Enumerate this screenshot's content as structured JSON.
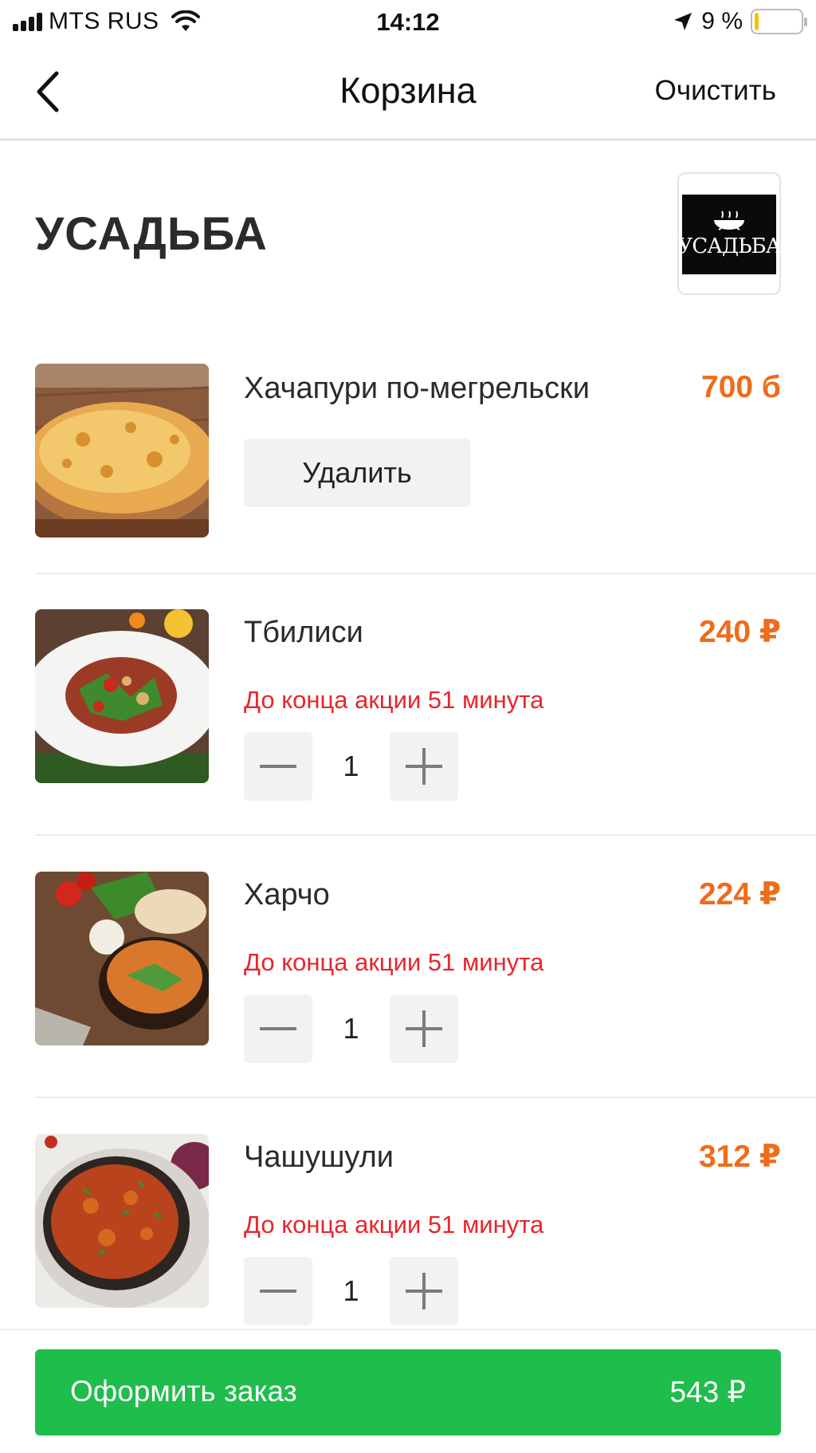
{
  "status_bar": {
    "carrier": "MTS RUS",
    "time": "14:12",
    "battery_percent": "9 %",
    "battery_level": 0.09,
    "icons": [
      "signal-icon",
      "wifi-icon",
      "location-arrow-icon",
      "battery-icon"
    ]
  },
  "nav": {
    "back_icon": "chevron-left-icon",
    "title": "Корзина",
    "clear_label": "Очистить"
  },
  "restaurant": {
    "name": "УСАДЬБА",
    "logo_text": "УСАДЬБА"
  },
  "items": [
    {
      "name": "Хачапури по-мегрельски",
      "price": "700 б",
      "action_label": "Удалить"
    },
    {
      "name": "Тбилиси",
      "price": "240 ₽",
      "promo": "До конца акции 51 минута",
      "quantity": "1"
    },
    {
      "name": "Харчо",
      "price": "224 ₽",
      "promo": "До конца акции 51 минута",
      "quantity": "1"
    },
    {
      "name": "Чашушули",
      "price": "312 ₽",
      "promo": "До конца акции 51 минута",
      "quantity": "1"
    }
  ],
  "checkout": {
    "label": "Оформить заказ",
    "total": "543 ₽"
  },
  "colors": {
    "price": "#ee6c1c",
    "promo": "#e8252c",
    "checkout": "#1fbd4b",
    "stepper_bg": "#f2f2f2"
  }
}
